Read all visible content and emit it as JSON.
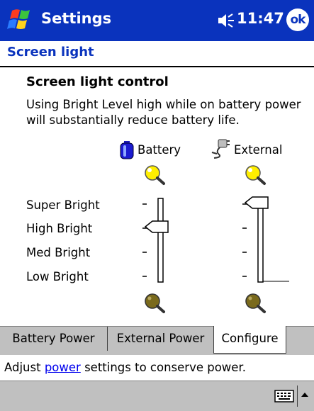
{
  "titlebar": {
    "app_title": "Settings",
    "clock": "11:47",
    "ok_label": "ok",
    "start_icon": "windows-flag-icon",
    "volume_icon": "speaker-icon",
    "bg_color": "#0a33bd"
  },
  "page": {
    "title": "Screen light",
    "title_color": "#0a33bd"
  },
  "content": {
    "heading": "Screen light control",
    "description": "Using Bright Level high while on battery power will substantially reduce battery life.",
    "columns": [
      {
        "label": "Battery",
        "icon": "battery-icon"
      },
      {
        "label": "External",
        "icon": "plug-icon"
      }
    ],
    "levels": [
      "Super Bright",
      "High Bright",
      "Med Bright",
      "Low Bright"
    ],
    "battery_setting": "High Bright",
    "external_setting": "Super Bright",
    "bright_icon": "bright-bulb-icon",
    "dim_icon": "dim-bulb-icon"
  },
  "tabs": [
    {
      "label": "Battery Power",
      "active": false
    },
    {
      "label": "External Power",
      "active": false
    },
    {
      "label": "Configure",
      "active": true
    }
  ],
  "footer": {
    "prefix": "Adjust ",
    "link": "power",
    "suffix": " settings to conserve power."
  },
  "menubar": {
    "keyboard_icon": "keyboard-icon",
    "arrow_icon": "up-arrow-icon"
  }
}
